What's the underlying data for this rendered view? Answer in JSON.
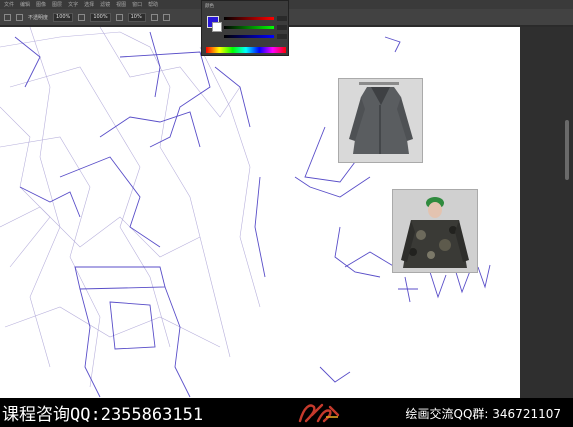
{
  "menubar": {
    "items": [
      "文件",
      "编辑",
      "图像",
      "图层",
      "文字",
      "选择",
      "滤镜",
      "视图",
      "窗口",
      "帮助"
    ]
  },
  "options": {
    "mode_label": "不透明度",
    "opacity": "100%",
    "flow": "100%",
    "smooth": "10%"
  },
  "color_panel": {
    "title": "颜色",
    "fg_color": "#2a18d8",
    "bg_color": "#ffffff"
  },
  "references": [
    {
      "name": "grey-coat-reference"
    },
    {
      "name": "camo-jacket-reference"
    }
  ],
  "footer": {
    "consult": "课程咨询QQ:2355863151",
    "group": "绘画交流QQ群: 346721107"
  }
}
